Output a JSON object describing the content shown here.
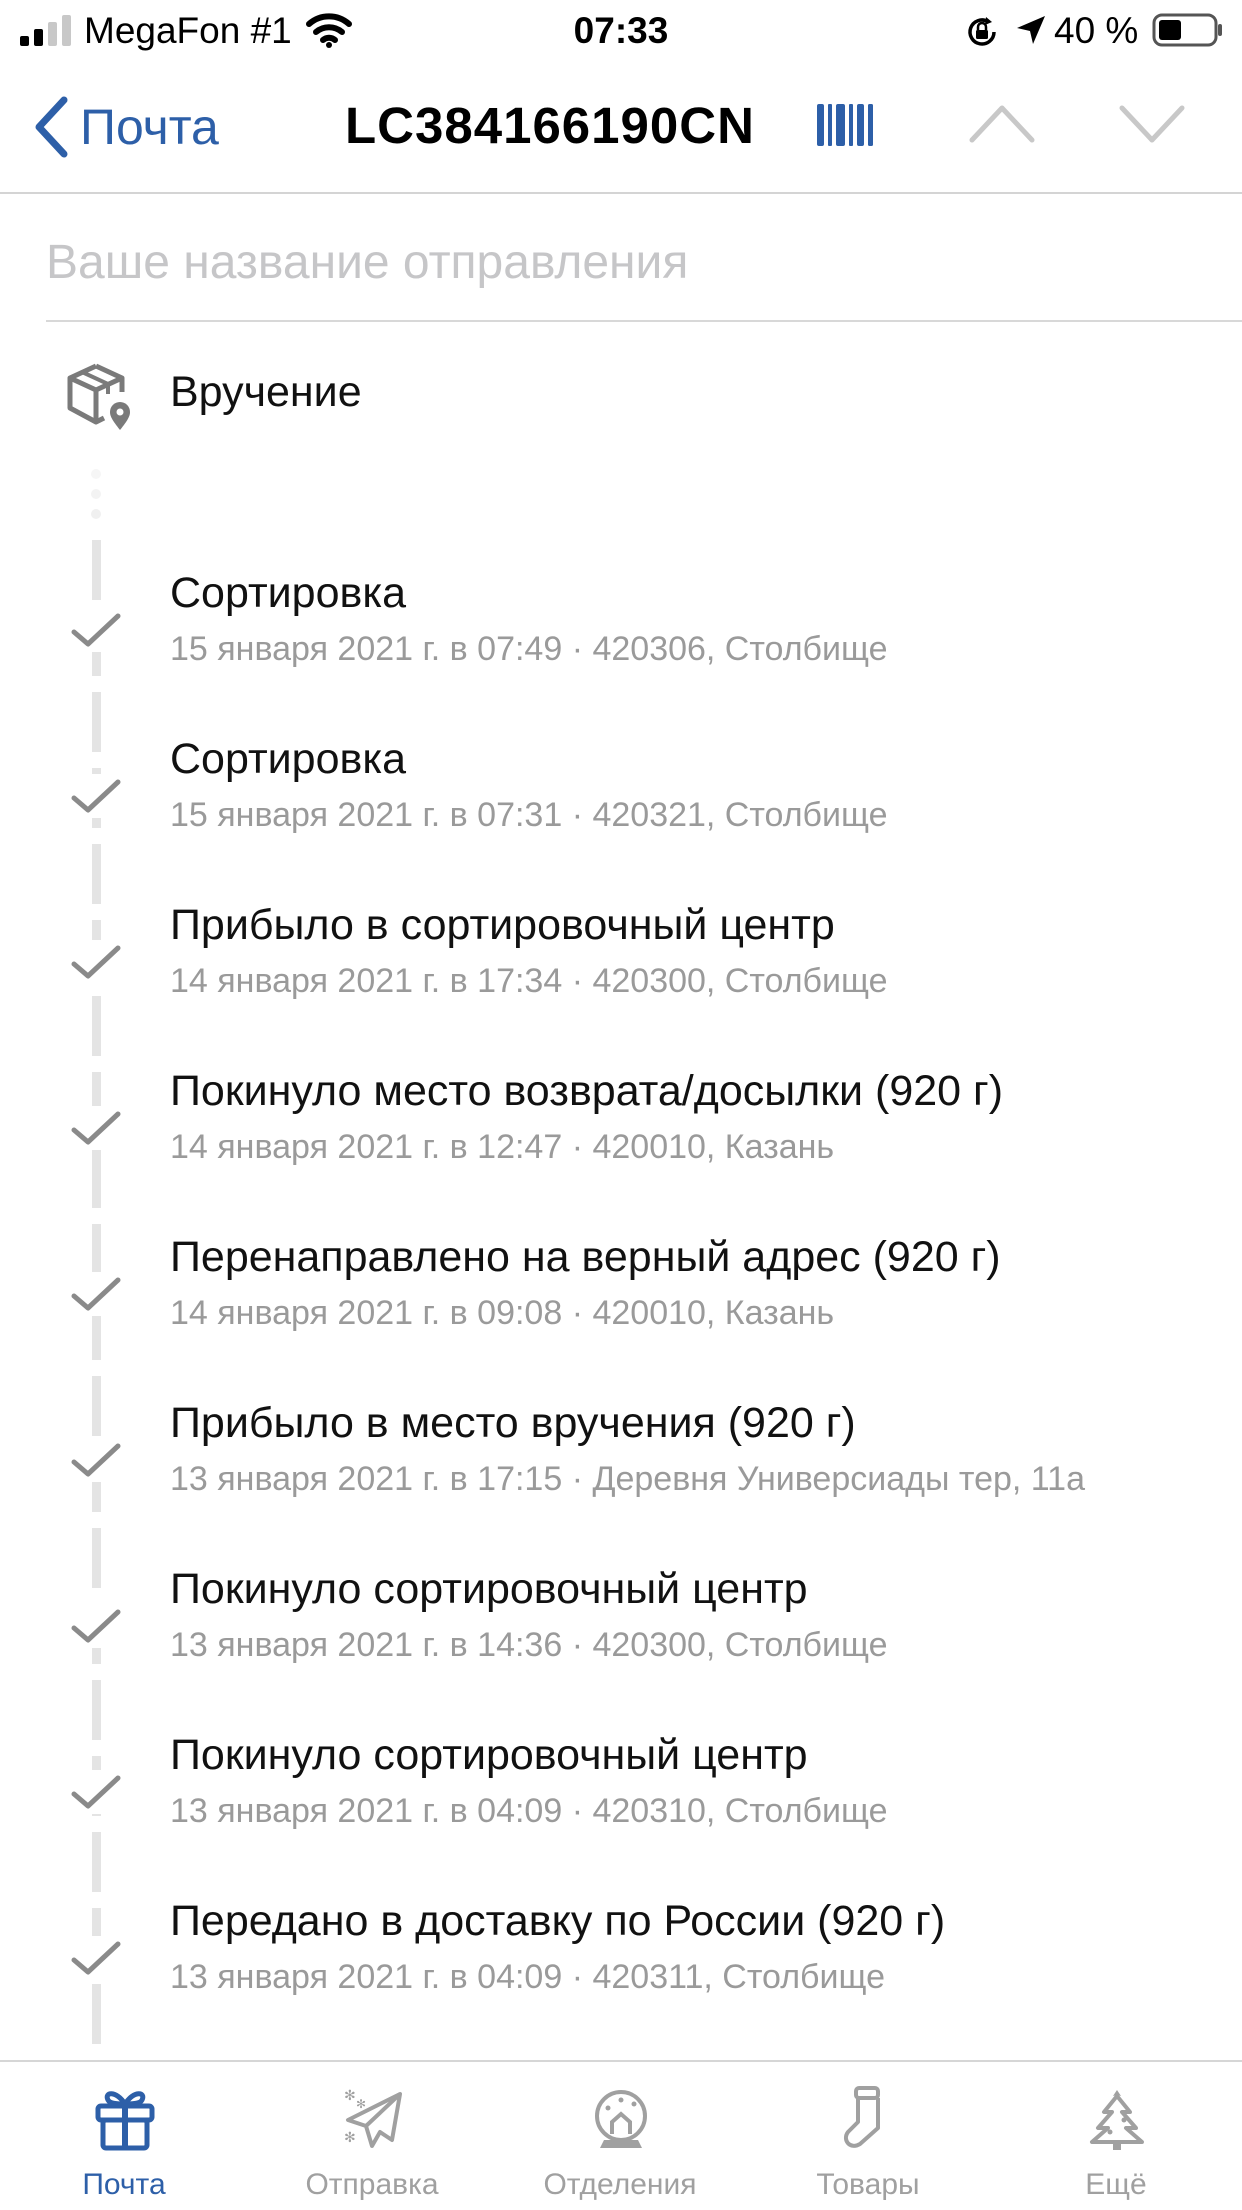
{
  "status_bar": {
    "carrier": "MegaFon #1",
    "time": "07:33",
    "battery": "40 %"
  },
  "nav": {
    "back_label": "Почта",
    "title": "LC384166190CN",
    "icons": [
      "barcode-icon",
      "chevron-up-icon",
      "chevron-down-icon"
    ]
  },
  "name_field": {
    "placeholder": "Ваше название отправления",
    "value": ""
  },
  "delivery": {
    "label": "Вручение",
    "icon": "parcel-location-icon"
  },
  "events": [
    {
      "title": "Сортировка",
      "subtitle": "15 января 2021 г. в 07:49 · 420306, Столбище"
    },
    {
      "title": "Сортировка",
      "subtitle": "15 января 2021 г. в 07:31 · 420321, Столбище"
    },
    {
      "title": "Прибыло в сортировочный центр",
      "subtitle": "14 января 2021 г. в 17:34 · 420300, Столбище"
    },
    {
      "title": "Покинуло место возврата/досылки  (920 г)",
      "subtitle": "14 января 2021 г. в 12:47 · 420010, Казань"
    },
    {
      "title": "Перенаправлено на верный адрес  (920 г)",
      "subtitle": "14 января 2021 г. в 09:08 · 420010, Казань"
    },
    {
      "title": "Прибыло в место вручения  (920 г)",
      "subtitle": "13 января 2021 г. в 17:15 · Деревня Универсиады тер, 11а"
    },
    {
      "title": "Покинуло сортировочный центр",
      "subtitle": "13 января 2021 г. в 14:36 · 420300, Столбище"
    },
    {
      "title": "Покинуло сортировочный центр",
      "subtitle": "13 января 2021 г. в 04:09 · 420310, Столбище"
    },
    {
      "title": "Передано в доставку по России  (920 г)",
      "subtitle": "13 января 2021 г. в 04:09 · 420311, Столбище"
    }
  ],
  "tabs": [
    {
      "label": "Почта",
      "icon": "gift-icon",
      "active": true
    },
    {
      "label": "Отправка",
      "icon": "paper-plane-icon",
      "active": false
    },
    {
      "label": "Отделения",
      "icon": "snow-globe-icon",
      "active": false
    },
    {
      "label": "Товары",
      "icon": "stocking-icon",
      "active": false
    },
    {
      "label": "Ещё",
      "icon": "christmas-tree-icon",
      "active": false
    }
  ],
  "colors": {
    "accent": "#2d5fa8",
    "secondary_text": "#9a9a9a",
    "check": "#8a8a8a",
    "inactive_tab": "#a0a0a0"
  }
}
